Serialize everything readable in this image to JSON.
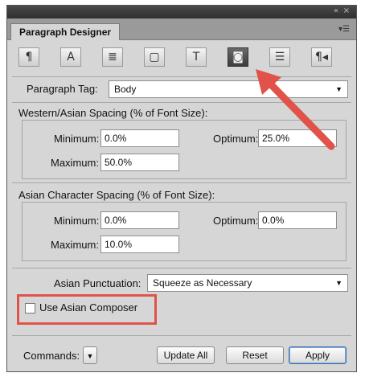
{
  "window": {
    "controls": {
      "collapse": "«",
      "close": "×"
    },
    "tab_title": "Paragraph Designer",
    "menu_icon": "panel-menu-icon"
  },
  "toolbar": {
    "buttons": [
      {
        "icon": "paragraph-icon",
        "glyph": "¶"
      },
      {
        "icon": "text-a-icon",
        "glyph": "A"
      },
      {
        "icon": "default-font-icon",
        "glyph": "≣"
      },
      {
        "icon": "pagination-icon",
        "glyph": "▢"
      },
      {
        "icon": "text-frame-icon",
        "glyph": "T"
      },
      {
        "icon": "asian-icon",
        "glyph": "◙",
        "active": true
      },
      {
        "icon": "table-cell-icon",
        "glyph": "☰"
      },
      {
        "icon": "direction-icon",
        "glyph": "¶◂"
      }
    ]
  },
  "paragraph_tag": {
    "label": "Paragraph Tag:",
    "value": "Body"
  },
  "western_asian": {
    "title": "Western/Asian Spacing (% of Font Size):",
    "minimum_label": "Minimum:",
    "minimum_value": "0.0%",
    "optimum_label": "Optimum:",
    "optimum_value": "25.0%",
    "maximum_label": "Maximum:",
    "maximum_value": "50.0%"
  },
  "asian_char": {
    "title": "Asian Character Spacing (% of Font Size):",
    "minimum_label": "Minimum:",
    "minimum_value": "0.0%",
    "optimum_label": "Optimum:",
    "optimum_value": "0.0%",
    "maximum_label": "Maximum:",
    "maximum_value": "10.0%"
  },
  "asian_punctuation": {
    "label": "Asian Punctuation:",
    "value": "Squeeze as Necessary"
  },
  "use_asian_composer": {
    "label": "Use Asian Composer",
    "checked": false
  },
  "footer": {
    "commands_label": "Commands:",
    "update_all": "Update All",
    "reset": "Reset",
    "apply": "Apply"
  },
  "annotation": {
    "highlight_color": "#e0524a"
  }
}
